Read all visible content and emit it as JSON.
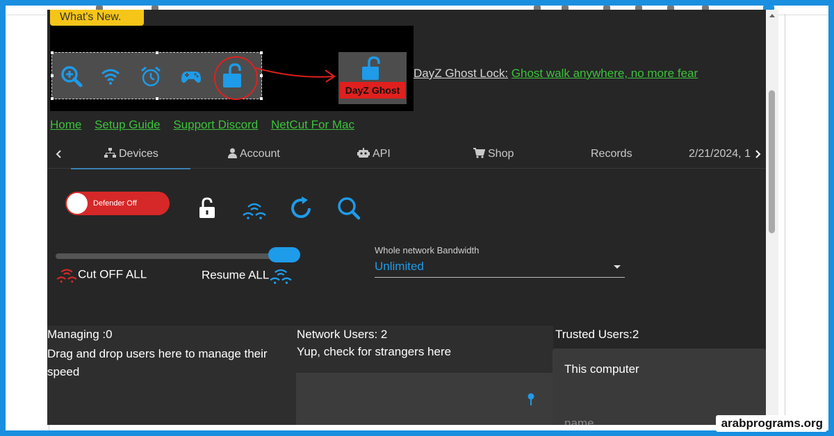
{
  "banner": {
    "whats_new": "What's New.",
    "ghost_label": "DayZ Ghost"
  },
  "promo": {
    "lead": "DayZ Ghost Lock:",
    "tail": "Ghost walk anywhere, no more fear"
  },
  "links": [
    "Home",
    "Setup Guide",
    "Support Discord",
    "NetCut For Mac"
  ],
  "tabs": {
    "devices": "Devices",
    "account": "Account",
    "api": "API",
    "shop": "Shop",
    "records": "Records",
    "datetime": "2/21/2024, 1"
  },
  "controls": {
    "defender": "Defender Off",
    "cut_all": "Cut OFF ALL",
    "resume_all": "Resume ALL",
    "bandwidth_label": "Whole network Bandwidth",
    "bandwidth_value": "Unlimited"
  },
  "columns": {
    "managing_title": "Managing :0",
    "managing_desc": "Drag and drop users here to manage their speed",
    "network_title": "Network Users: 2",
    "network_desc": "Yup, check for strangers here",
    "trusted_title": "Trusted Users:2",
    "trusted_card_title": "This computer",
    "trusted_card_sub": "name"
  },
  "watermark": "arabprograms.org",
  "colors": {
    "accent_blue": "#1e9be9",
    "link_green": "#3cc23c",
    "danger_red": "#d62828",
    "whats_new_yellow": "#f5c518",
    "app_background": "#262626"
  }
}
